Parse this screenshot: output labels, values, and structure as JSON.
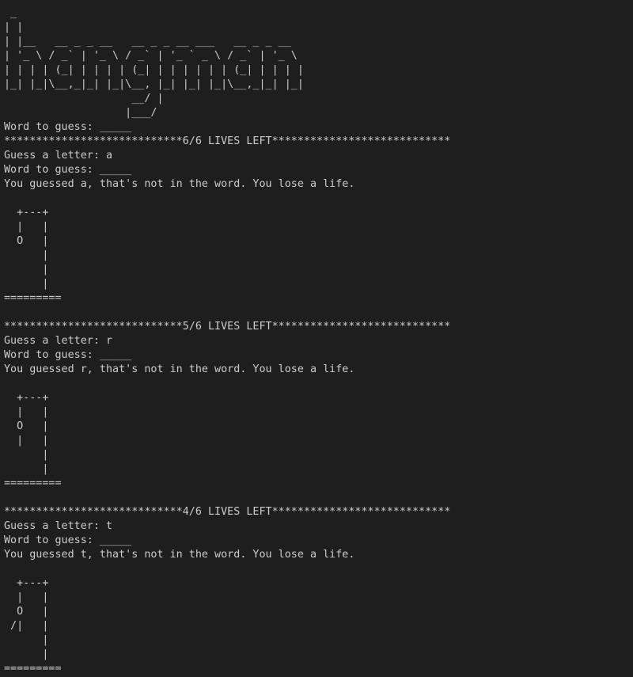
{
  "terminal": {
    "lines": [
      " _",
      "| |",
      "| |__   __ _ _ __   __ _ _ __ ___   __ _ _ __",
      "| '_ \\ / _` | '_ \\ / _` | '_ ` _ \\ / _` | '_ \\",
      "| | | | (_| | | | | (_| | | | | | | (_| | | | |",
      "|_| |_|\\__,_|_| |_|\\__, |_| |_| |_|\\__,_|_| |_|",
      "                    __/ |",
      "                   |___/",
      "Word to guess: _____",
      "****************************6/6 LIVES LEFT****************************",
      "Guess a letter: a",
      "Word to guess: _____",
      "You guessed a, that's not in the word. You lose a life.",
      "",
      "  +---+",
      "  |   |",
      "  O   |",
      "      |",
      "      |",
      "      |",
      "=========",
      "",
      "****************************5/6 LIVES LEFT****************************",
      "Guess a letter: r",
      "Word to guess: _____",
      "You guessed r, that's not in the word. You lose a life.",
      "",
      "  +---+",
      "  |   |",
      "  O   |",
      "  |   |",
      "      |",
      "      |",
      "=========",
      "",
      "****************************4/6 LIVES LEFT****************************",
      "Guess a letter: t",
      "Word to guess: _____",
      "You guessed t, that's not in the word. You lose a life.",
      "",
      "  +---+",
      "  |   |",
      "  O   |",
      " /|   |",
      "      |",
      "      |",
      "========="
    ]
  }
}
